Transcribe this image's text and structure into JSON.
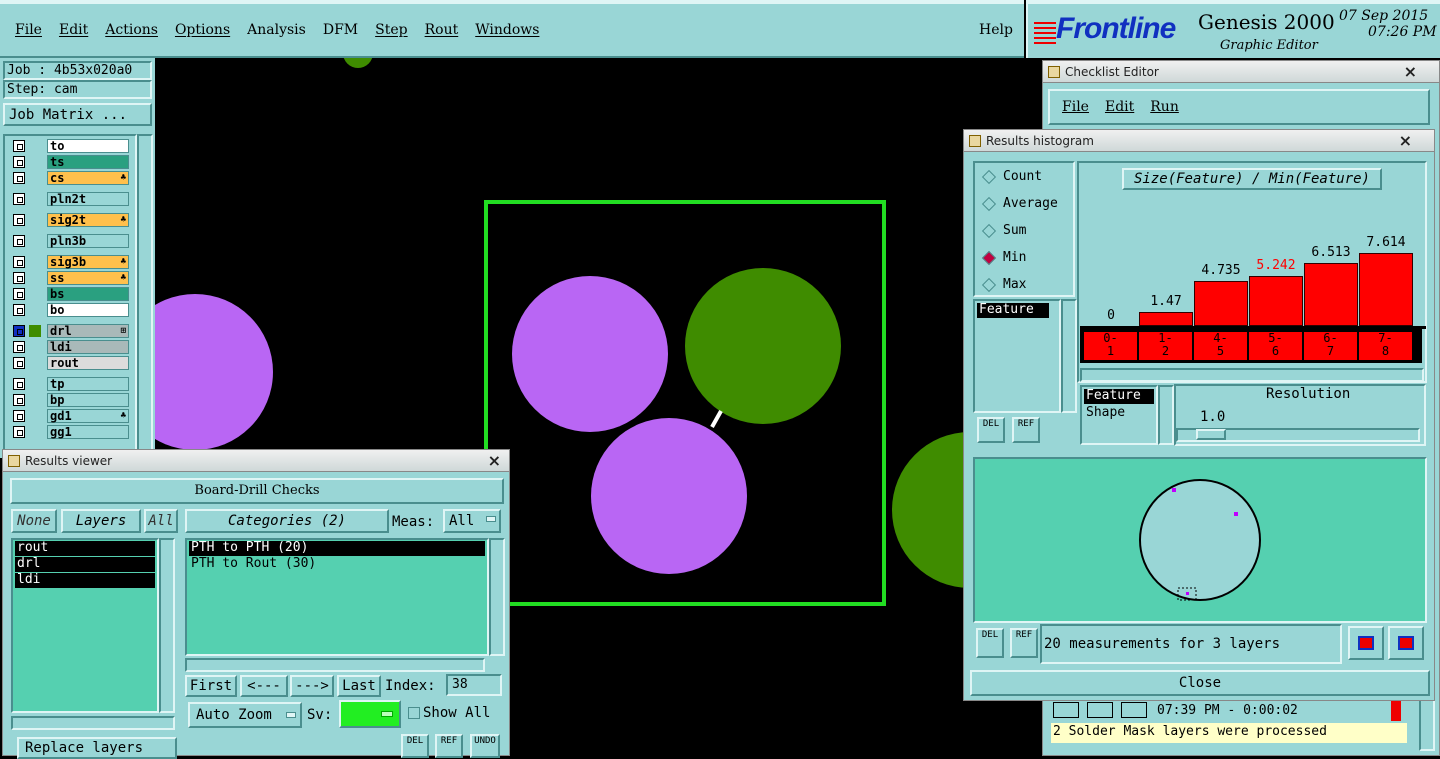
{
  "menubar": {
    "items": [
      "File",
      "Edit",
      "Actions",
      "Options",
      "Analysis",
      "DFM",
      "Step",
      "Rout",
      "Windows"
    ],
    "help": "Help"
  },
  "brand": {
    "logo": "Frontline",
    "product": "Genesis 2000",
    "subtitle": "Graphic Editor",
    "date": "07 Sep 2015",
    "time": "07:26 PM"
  },
  "job": {
    "job": "Job : 4b53x020a0",
    "step": "Step: cam",
    "matrix_button": "Job Matrix ..."
  },
  "layers": [
    {
      "name": "to",
      "color": "#ffffff",
      "flag": ""
    },
    {
      "name": "ts",
      "color": "#2aa080",
      "flag": ""
    },
    {
      "name": "cs",
      "color": "#ffc04c",
      "flag": "♣"
    },
    {
      "name": "pln2t",
      "color": "#99d6d6",
      "flag": ""
    },
    {
      "name": "sig2t",
      "color": "#ffc04c",
      "flag": "♣"
    },
    {
      "name": "pln3b",
      "color": "#99d6d6",
      "flag": ""
    },
    {
      "name": "sig3b",
      "color": "#ffc04c",
      "flag": "♣"
    },
    {
      "name": "ss",
      "color": "#ffc04c",
      "flag": "♣"
    },
    {
      "name": "bs",
      "color": "#2aa080",
      "flag": ""
    },
    {
      "name": "bo",
      "color": "#ffffff",
      "flag": ""
    },
    {
      "name": "drl",
      "color": "#a9b9b9",
      "flag": "⊞"
    },
    {
      "name": "ldi",
      "color": "#a9b9b9",
      "flag": ""
    },
    {
      "name": "rout",
      "color": "#dcdcdc",
      "flag": ""
    },
    {
      "name": "tp",
      "color": "#99d6d6",
      "flag": ""
    },
    {
      "name": "bp",
      "color": "#99d6d6",
      "flag": ""
    },
    {
      "name": "gd1",
      "color": "#99d6d6",
      "flag": "♣"
    },
    {
      "name": "gg1",
      "color": "#99d6d6",
      "flag": ""
    }
  ],
  "results_viewer": {
    "title": "Results viewer",
    "header": "Board-Drill Checks",
    "none": "None",
    "layers": "Layers",
    "all": "All",
    "categories": "Categories (2)",
    "meas_label": "Meas:",
    "meas_value": "All",
    "layer_list": [
      "rout",
      "drl",
      "ldi"
    ],
    "category_list": [
      "PTH to PTH  (20)",
      "PTH to Rout  (30)"
    ],
    "first": "First",
    "prev": "<---",
    "next": "--->",
    "last": "Last",
    "index_label": "Index:",
    "index_value": "38",
    "zoom": "Auto Zoom",
    "sv_label": "Sv:",
    "show_all": "Show All",
    "replace": "Replace layers",
    "del": "DEL",
    "ref": "REF",
    "undo": "UNDO"
  },
  "checklist": {
    "title": "Checklist Editor",
    "menu": [
      "File",
      "Edit",
      "Run"
    ],
    "status_time": "07:39 PM - 0:00:02",
    "status_msg": "2 Solder Mask layers were processed"
  },
  "histogram": {
    "title": "Results histogram",
    "modes": [
      "Count",
      "Average",
      "Sum",
      "Min",
      "Max"
    ],
    "selected_mode": "Min",
    "chart_title": "Size(Feature) / Min(Feature)",
    "list_header": "Feature",
    "feature_label": "Feature",
    "shape_label": "Shape",
    "resolution_label": "Resolution",
    "resolution_value": "1.0",
    "del": "DEL",
    "ref": "REF",
    "measurements": "20 measurements for 3 layers",
    "close": "Close",
    "highlight_color": "#ff0000"
  },
  "chart_data": {
    "type": "bar",
    "title": "Size(Feature) / Min(Feature)",
    "categories": [
      "0-1",
      "1-2",
      "4-5",
      "5-6",
      "6-7",
      "7-8"
    ],
    "values": [
      0,
      1.47,
      4.735,
      5.242,
      6.513,
      7.614
    ],
    "value_labels": [
      "0",
      "1.47",
      "4.735",
      "5.242",
      "6.513",
      "7.614"
    ],
    "highlighted": "5.242",
    "ylim": [
      0,
      8
    ]
  }
}
